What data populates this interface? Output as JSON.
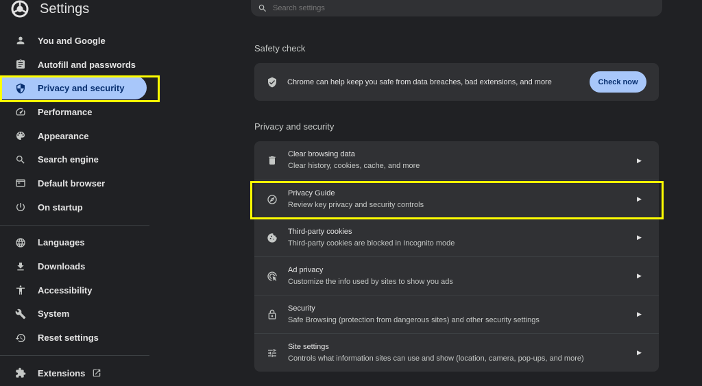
{
  "header": {
    "title": "Settings",
    "logo_icon": "chrome-logo-icon"
  },
  "search": {
    "placeholder": "Search settings"
  },
  "sidebar": {
    "items": [
      {
        "label": "You and Google",
        "icon": "person-icon"
      },
      {
        "label": "Autofill and passwords",
        "icon": "clipboard-icon"
      },
      {
        "label": "Privacy and security",
        "icon": "shield-icon",
        "active": true
      },
      {
        "label": "Performance",
        "icon": "speedometer-icon"
      },
      {
        "label": "Appearance",
        "icon": "palette-icon"
      },
      {
        "label": "Search engine",
        "icon": "search-icon"
      },
      {
        "label": "Default browser",
        "icon": "browser-icon"
      },
      {
        "label": "On startup",
        "icon": "power-icon"
      }
    ],
    "items2": [
      {
        "label": "Languages",
        "icon": "globe-icon"
      },
      {
        "label": "Downloads",
        "icon": "download-icon"
      },
      {
        "label": "Accessibility",
        "icon": "accessibility-icon"
      },
      {
        "label": "System",
        "icon": "wrench-icon"
      },
      {
        "label": "Reset settings",
        "icon": "history-icon"
      }
    ],
    "extensions": {
      "label": "Extensions",
      "icon": "puzzle-icon",
      "link_icon": "open-in-new-icon"
    }
  },
  "safety_check": {
    "title": "Safety check",
    "text": "Chrome can help keep you safe from data breaches, bad extensions, and more",
    "button": "Check now"
  },
  "privacy": {
    "title": "Privacy and security",
    "rows": [
      {
        "title": "Clear browsing data",
        "subtitle": "Clear history, cookies, cache, and more",
        "icon": "trash-icon"
      },
      {
        "title": "Privacy Guide",
        "subtitle": "Review key privacy and security controls",
        "icon": "compass-icon"
      },
      {
        "title": "Third-party cookies",
        "subtitle": "Third-party cookies are blocked in Incognito mode",
        "icon": "cookie-icon"
      },
      {
        "title": "Ad privacy",
        "subtitle": "Customize the info used by sites to show you ads",
        "icon": "ad-privacy-icon"
      },
      {
        "title": "Security",
        "subtitle": "Safe Browsing (protection from dangerous sites) and other security settings",
        "icon": "lock-icon"
      },
      {
        "title": "Site settings",
        "subtitle": "Controls what information sites can use and show (location, camera, pop-ups, and more)",
        "icon": "tune-icon"
      }
    ]
  },
  "colors": {
    "background": "#202124",
    "card": "#303134",
    "accent": "#a8c7fa",
    "highlight": "#ffff00"
  }
}
